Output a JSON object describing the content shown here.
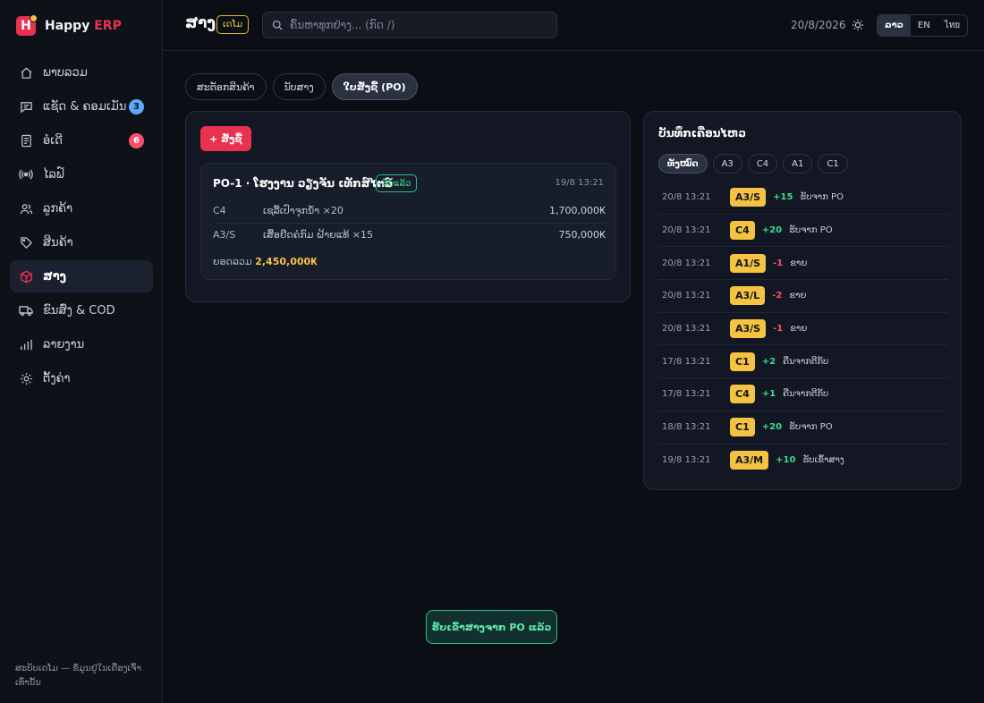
{
  "brand": {
    "name": "Happy",
    "accent": "ERP",
    "logo_letter": "H"
  },
  "sidebar": {
    "items": [
      {
        "label": "ພາບລວມ",
        "icon": "home-icon",
        "active": false
      },
      {
        "label": "ແຊັດ & ຄອມເມັນ",
        "icon": "chat-icon",
        "active": false,
        "badge": "3",
        "badge_color": "#5aa9ff"
      },
      {
        "label": "ອໍເດີ",
        "icon": "receipt-icon",
        "active": false,
        "badge": "6",
        "badge_color": "#ff4f6a"
      },
      {
        "label": "ໄລຟ໌",
        "icon": "live-icon",
        "active": false
      },
      {
        "label": "ລູກຄ້າ",
        "icon": "users-icon",
        "active": false
      },
      {
        "label": "ສິນຄ້າ",
        "icon": "tag-icon",
        "active": false
      },
      {
        "label": "ສາງ",
        "icon": "box-icon",
        "active": true
      },
      {
        "label": "ຂົນສົ່ງ & COD",
        "icon": "truck-icon",
        "active": false
      },
      {
        "label": "ລາຍງານ",
        "icon": "chart-icon",
        "active": false
      },
      {
        "label": "ຕັ້ງຄ່າ",
        "icon": "gear-icon",
        "active": false
      }
    ],
    "footer": "ສະບັບເດໂມ — ຂໍ້ມູນຢູ່ໃນເຄື່ອງເຈົ້າເທົ່ານັ້ນ"
  },
  "header": {
    "title": "ສາງ",
    "demo_badge": "ເດໂມ",
    "search_placeholder": "ຄົ້ນຫາທຸກຢ່າງ... (ກົດ /)",
    "date": "20/8/2026",
    "languages": [
      {
        "label": "ລາວ",
        "active": true
      },
      {
        "label": "EN",
        "active": false
      },
      {
        "label": "ไทย",
        "active": false
      }
    ]
  },
  "tabs": [
    {
      "label": "ສະຕັອກສິນຄ້າ",
      "active": false
    },
    {
      "label": "ນັບສາງ",
      "active": false
    },
    {
      "label": "ໃບສັ່ງຊື້ (PO)",
      "active": true
    }
  ],
  "po_panel": {
    "new_button": "+ ສັ່ງຊື້",
    "orders": [
      {
        "title": "PO-1 · ໂຮງງານ ວຽງຈັນ ເທັກສ໌ໄຕລ໌",
        "status": "ຮັບແລ້ວ",
        "time": "19/8 13:21",
        "lines": [
          {
            "code": "C4",
            "desc": "ເຊລື້ເປົາຈຸກນ້ຳ ×20",
            "amount": "1,700,000₭"
          },
          {
            "code": "A3/S",
            "desc": "ເສື້ອຢືດຄໍກົມ ຝ້າຍແທ້ ×15",
            "amount": "750,000₭"
          }
        ],
        "total_label": "ຍອດລວມ",
        "total_value": "2,450,000₭"
      }
    ]
  },
  "movement_log": {
    "title": "ບັນທຶກເຄື່ອນໄຫວ",
    "filters": [
      {
        "label": "ທັງໝົດ",
        "active": true
      },
      {
        "label": "A3",
        "active": false
      },
      {
        "label": "C4",
        "active": false
      },
      {
        "label": "A1",
        "active": false
      },
      {
        "label": "C1",
        "active": false
      }
    ],
    "entries": [
      {
        "time": "20/8 13:21",
        "sku": "A3/S",
        "qty": "+15",
        "note": "ຮັບຈາກ PO"
      },
      {
        "time": "20/8 13:21",
        "sku": "C4",
        "qty": "+20",
        "note": "ຮັບຈາກ PO"
      },
      {
        "time": "20/8 13:21",
        "sku": "A1/S",
        "qty": "-1",
        "note": "ຂາຍ"
      },
      {
        "time": "20/8 13:21",
        "sku": "A3/L",
        "qty": "-2",
        "note": "ຂາຍ"
      },
      {
        "time": "20/8 13:21",
        "sku": "A3/S",
        "qty": "-1",
        "note": "ຂາຍ"
      },
      {
        "time": "17/8 13:21",
        "sku": "C1",
        "qty": "+2",
        "note": "ຄືນຈາກຕີກັບ"
      },
      {
        "time": "17/8 13:21",
        "sku": "C4",
        "qty": "+1",
        "note": "ຄືນຈາກຕີກັບ"
      },
      {
        "time": "18/8 13:21",
        "sku": "C1",
        "qty": "+20",
        "note": "ຮັບຈາກ PO"
      },
      {
        "time": "19/8 13:21",
        "sku": "A3/M",
        "qty": "+10",
        "note": "ຮັບເຂົ້າສາງ"
      }
    ]
  },
  "toast": "ຮັບເຂົ້າສາງຈາກ PO ແລ້ວ",
  "colors": {
    "accent": "#e8324f",
    "sku_badge": "#f5c342",
    "positive": "#3ddc8c",
    "negative": "#ff4f6a"
  }
}
